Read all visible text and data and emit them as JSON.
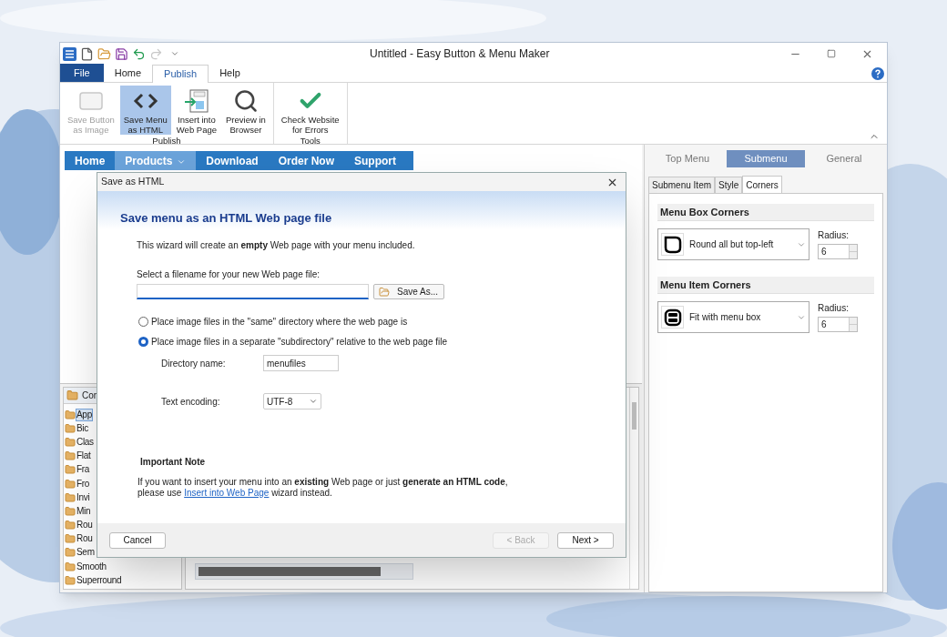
{
  "window": {
    "title": "Untitled - Easy Button & Menu Maker"
  },
  "ribbon": {
    "tabs": [
      {
        "label": "File",
        "kind": "file",
        "selected": false
      },
      {
        "label": "Home",
        "kind": "tab",
        "selected": false
      },
      {
        "label": "Publish",
        "kind": "tab",
        "selected": true
      },
      {
        "label": "Help",
        "kind": "tab",
        "selected": false
      }
    ],
    "groups": [
      {
        "label": "Publish",
        "buttons": [
          {
            "lines": [
              "Save Button",
              "as Image"
            ],
            "kind": "blank",
            "disabled": true,
            "selected": false
          },
          {
            "lines": [
              "Save Menu",
              "as HTML"
            ],
            "kind": "code",
            "disabled": false,
            "selected": true
          },
          {
            "lines": [
              "Insert into",
              "Web Page"
            ],
            "kind": "insert",
            "disabled": false,
            "selected": false
          },
          {
            "lines": [
              "Preview in",
              "Browser"
            ],
            "kind": "search",
            "disabled": false,
            "selected": false
          }
        ]
      },
      {
        "label": "Tools",
        "buttons": [
          {
            "lines": [
              "Check Website",
              "for Errors"
            ],
            "kind": "check",
            "disabled": false,
            "selected": false
          }
        ]
      }
    ]
  },
  "preview_menu": {
    "items": [
      {
        "label": "Home",
        "selected": false,
        "submenu": false
      },
      {
        "label": "Products",
        "selected": true,
        "submenu": true
      },
      {
        "label": "Download",
        "selected": false,
        "submenu": false
      },
      {
        "label": "Order Now",
        "selected": false,
        "submenu": false
      },
      {
        "label": "Support",
        "selected": false,
        "submenu": false
      }
    ]
  },
  "style_list": {
    "header": "Cor",
    "items": [
      {
        "label": "App",
        "selected": true
      },
      {
        "label": "Bic",
        "selected": false
      },
      {
        "label": "Clas",
        "selected": false
      },
      {
        "label": "Flat",
        "selected": false
      },
      {
        "label": "Fra",
        "selected": false
      },
      {
        "label": "Fro",
        "selected": false
      },
      {
        "label": "Invi",
        "selected": false
      },
      {
        "label": "Min",
        "selected": false
      },
      {
        "label": "Rou",
        "selected": false
      },
      {
        "label": "Rou",
        "selected": false
      },
      {
        "label": "Sem",
        "selected": false
      },
      {
        "label": "Smooth",
        "selected": false
      },
      {
        "label": "Superround",
        "selected": false
      }
    ]
  },
  "properties": {
    "tabs": [
      {
        "label": "Top Menu",
        "selected": false
      },
      {
        "label": "Submenu",
        "selected": true
      },
      {
        "label": "General",
        "selected": false
      }
    ],
    "subtabs": [
      {
        "label": "Submenu Item",
        "selected": false
      },
      {
        "label": "Style",
        "selected": false
      },
      {
        "label": "Corners",
        "selected": true
      }
    ],
    "sections": [
      {
        "title": "Menu Box Corners",
        "kind": "box",
        "value": "Round all but top-left",
        "radius_label": "Radius:",
        "radius": "6"
      },
      {
        "title": "Menu Item Corners",
        "kind": "item",
        "value": "Fit with menu box",
        "radius_label": "Radius:",
        "radius": "6"
      }
    ]
  },
  "dialog": {
    "title": "Save as HTML",
    "heading": "Save menu as an HTML Web page file",
    "intro": "This wizard will create an **empty** Web page with your menu included.",
    "filename_label": "Select a filename for your new Web page file:",
    "save_as": "Save As...",
    "options": [
      {
        "label": "Place image files in the \"same\" directory where the web page is",
        "selected": false
      },
      {
        "label": "Place image files in a separate \"subdirectory\" relative to the web page file",
        "selected": true
      }
    ],
    "directory_label": "Directory name:",
    "directory_value": "menufiles",
    "encoding_label": "Text encoding:",
    "encoding_value": "UTF-8",
    "note_title": "Important Note",
    "note_line1": "If you want to insert your menu into an **existing** Web page or just **generate an HTML code**,",
    "note_before_link": "please use",
    "note_link": "Insert into Web Page",
    "note_after_link": "wizard instead.",
    "buttons": [
      {
        "label": "Cancel",
        "disabled": false
      },
      {
        "label": "< Back",
        "disabled": true
      },
      {
        "label": "Next >",
        "disabled": false
      }
    ]
  }
}
